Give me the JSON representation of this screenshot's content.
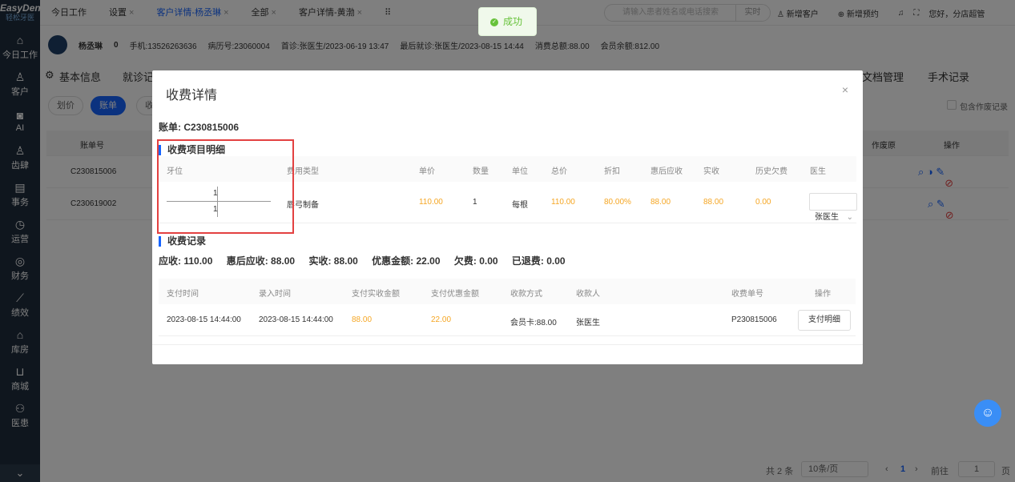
{
  "sidebar": {
    "brand": "EasyDent",
    "brand_sub": "轻松牙医",
    "items": [
      {
        "icon": "home-icon",
        "glyph": "⌂",
        "label": "今日工作"
      },
      {
        "icon": "user-icon",
        "glyph": "♙",
        "label": "客户"
      },
      {
        "icon": "ai-icon",
        "glyph": "◙",
        "label": "AI"
      },
      {
        "icon": "schedule-icon",
        "glyph": "♙",
        "label": "齿肆"
      },
      {
        "icon": "document-icon",
        "glyph": "▤",
        "label": "事务"
      },
      {
        "icon": "clock-icon",
        "glyph": "◷",
        "label": "运营"
      },
      {
        "icon": "finance-icon",
        "glyph": "◎",
        "label": "财务"
      },
      {
        "icon": "chart-icon",
        "glyph": "⟋",
        "label": "绩效"
      },
      {
        "icon": "warehouse-icon",
        "glyph": "⌂",
        "label": "库房"
      },
      {
        "icon": "cart-icon",
        "glyph": "⊔",
        "label": "商城"
      },
      {
        "icon": "doctor-patient-icon",
        "glyph": "⚇",
        "label": "医患"
      }
    ],
    "more_glyph": "⌄"
  },
  "topbar": {
    "tabs": [
      {
        "label": "今日工作",
        "active": false,
        "closable": false
      },
      {
        "label": "设置",
        "active": false,
        "closable": true
      },
      {
        "label": "客户详情-杨丞琳",
        "active": true,
        "closable": true
      },
      {
        "label": "全部",
        "active": false,
        "closable": true
      },
      {
        "label": "客户详情-黄渤",
        "active": false,
        "closable": true
      }
    ],
    "grid_glyph": "⠿",
    "close_glyph": "×",
    "search_placeholder": "请输入患者姓名或电话搜索",
    "search_btn": "实时",
    "new_customer": "新增客户",
    "new_appointment": "新增预约",
    "greeting": "您好，分店超管"
  },
  "patient": {
    "name": "杨丞琳",
    "count": "0",
    "phone": "手机:13526263636",
    "record_no": "病历号:23060004",
    "first_visit": "首诊:张医生/2023-06-19 13:47",
    "last_visit": "最后就诊:张医生/2023-08-15 14:44",
    "total_spend": "消费总额:88.00",
    "member_balance": "会员余额:812.00"
  },
  "subtabs": {
    "basic": "基本信息",
    "visit": "就诊记",
    "docs": "文档管理",
    "surgery": "手术记录"
  },
  "buttons": {
    "plan": "划价",
    "bill": "账单",
    "charge": "收"
  },
  "include_void": "包含作废记录",
  "bg_table": {
    "col_bill": "账单号",
    "col_void": "作废原",
    "col_op": "操作",
    "rows": [
      "C230815006",
      "C230619002"
    ]
  },
  "footer": {
    "total": "共 2 条",
    "page_size": "10条/页",
    "page": "1",
    "goto": "前往",
    "goto_value": "1",
    "page_unit": "页"
  },
  "toast": {
    "message": "成功"
  },
  "modal": {
    "title": "收费详情",
    "close_glyph": "×",
    "bill_no": "账单: C230815006",
    "items_section": "收费项目明细",
    "items_headers": [
      "牙位",
      "费用类型",
      "单价",
      "数量",
      "单位",
      "总价",
      "折扣",
      "惠后应收",
      "实收",
      "历史欠费",
      "医生"
    ],
    "item": {
      "tooth_upper": "1",
      "tooth_lower": "1",
      "fee_type": "唇弓制备",
      "unit_price": "110.00",
      "qty": "1",
      "unit": "每根",
      "total": "110.00",
      "discount": "80.00%",
      "after_discount": "88.00",
      "received": "88.00",
      "history_debt": "0.00",
      "doctor": "张医生"
    },
    "records_section": "收费记录",
    "summary": {
      "receivable": "应收: 110.00",
      "discounted_receivable": "惠后应收: 88.00",
      "received": "实收: 88.00",
      "discount_amount": "优惠金额: 22.00",
      "debt": "欠费: 0.00",
      "refunded": "已退费: 0.00"
    },
    "records_headers": [
      "支付时间",
      "录入时间",
      "支付实收金额",
      "支付优惠金额",
      "收款方式",
      "收款人",
      "收费单号",
      "操作"
    ],
    "record": {
      "pay_time": "2023-08-15 14:44:00",
      "entry_time": "2023-08-15 14:44:00",
      "paid_amount": "88.00",
      "discount_amount": "22.00",
      "method": "会员卡:88.00",
      "payee": "张医生",
      "receipt_no": "P230815006",
      "detail_btn": "支付明细"
    }
  },
  "colors": {
    "accent": "#1664ff",
    "orange": "#f5a623",
    "highlight": "#e34141",
    "sidebar": "#1f2d3d"
  }
}
